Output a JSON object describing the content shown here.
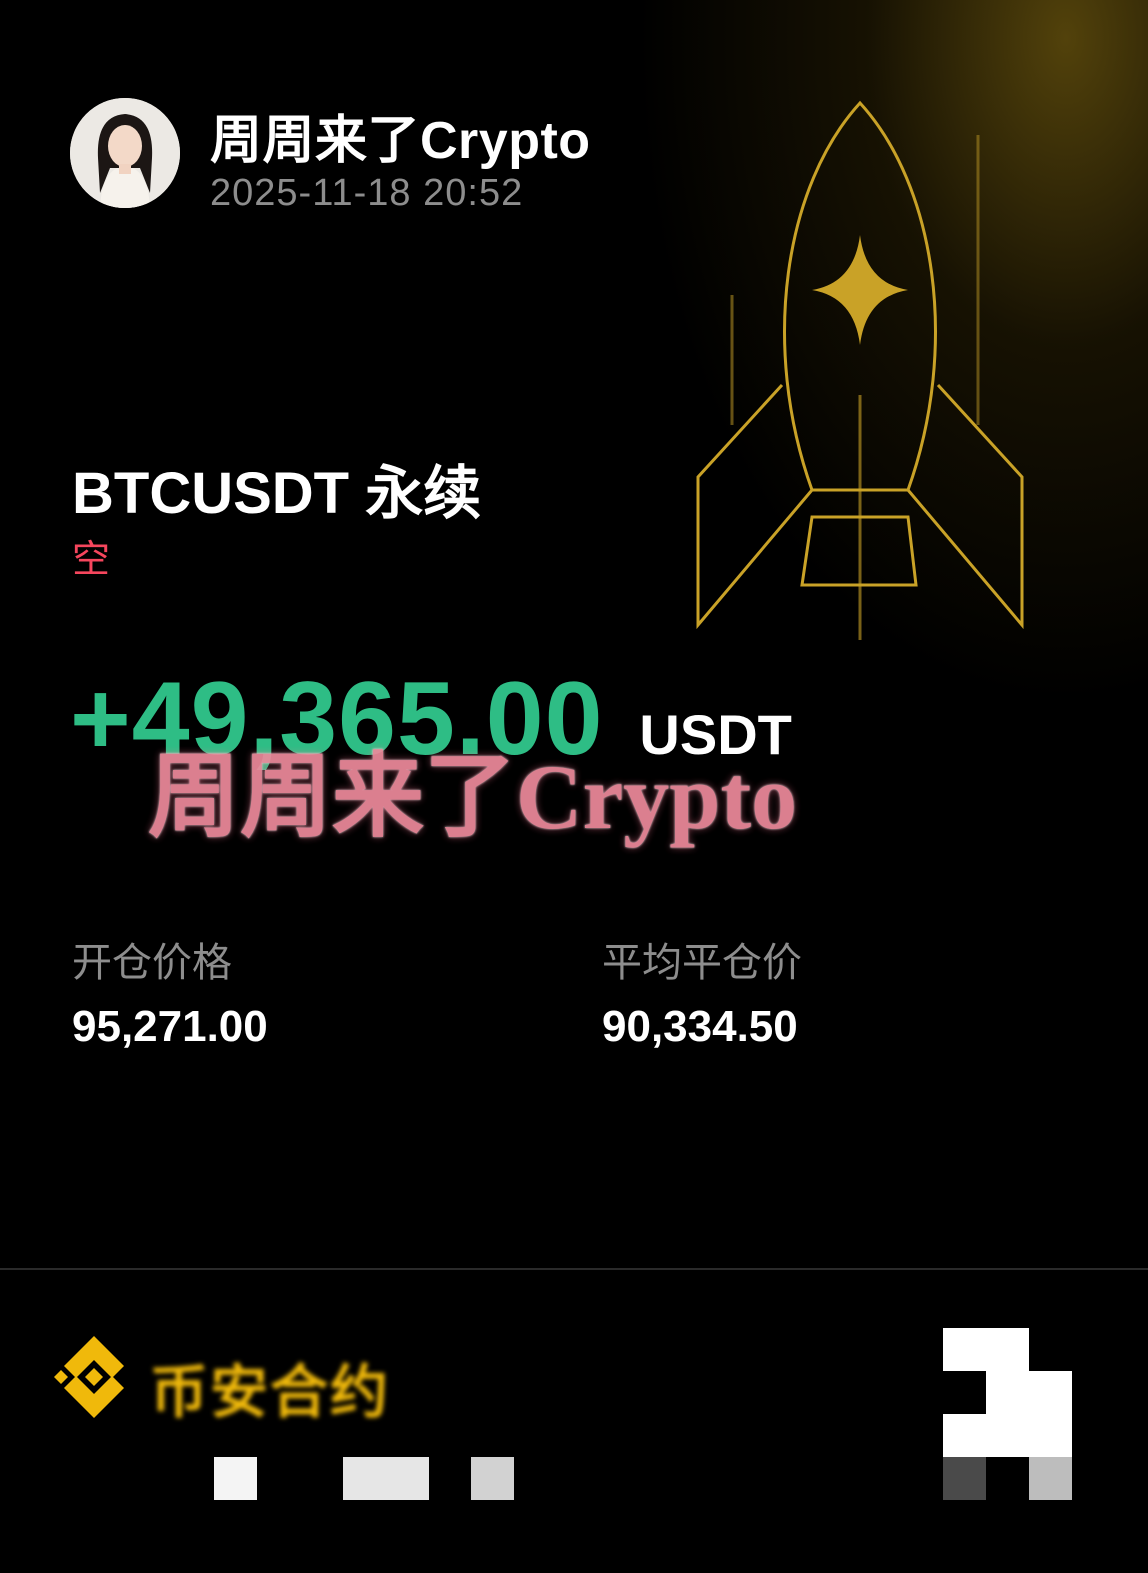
{
  "post": {
    "author": "周周来了Crypto",
    "timestamp": "2025-11-18 20:52"
  },
  "trade": {
    "symbol": "BTCUSDT 永续",
    "side": "空",
    "pnl": "+49,365.00",
    "pnl_unit": "USDT",
    "entry_price_label": "开仓价格",
    "entry_price": "95,271.00",
    "avg_close_label": "平均平仓价",
    "avg_close_price": "90,334.50"
  },
  "watermark": "周周来了Crypto",
  "footer": {
    "brand_name": "币安合约"
  },
  "colors": {
    "profit_green": "#2ebd85",
    "short_red": "#f6465d",
    "rocket_gold": "#c9a227",
    "brand_yellow": "#f0b90b"
  }
}
